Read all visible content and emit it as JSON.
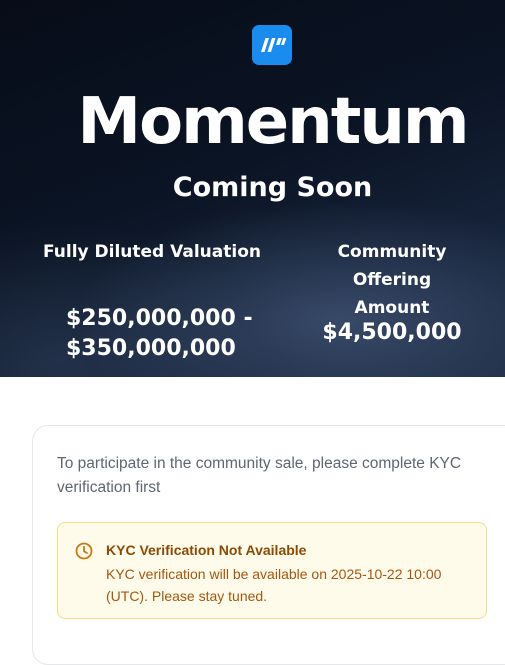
{
  "hero": {
    "logo_icon": "momentum-logo-icon",
    "brand_name": "Momentum",
    "status": "Coming Soon",
    "fdv": {
      "label": "Fully Diluted Valuation",
      "value_line1": "$250,000,000 -",
      "value_line2": "$350,000,000"
    },
    "community_offering": {
      "label_line1": "Community Offering",
      "label_line2": "Amount",
      "value": "$4,500,000"
    }
  },
  "sale_card": {
    "instructions": "To participate in the community sale, please complete KYC verification first",
    "notice": {
      "icon": "clock-icon",
      "title": "KYC Verification Not Available",
      "body": "KYC verification will be available on 2025-10-22 10:00 (UTC). Please stay tuned."
    }
  },
  "colors": {
    "logo_blue": "#1a8cf0",
    "notice_background": "#fffbeb",
    "notice_border": "#f6dc8a",
    "notice_title": "#8a4a06",
    "notice_text": "#a8560e",
    "muted_text": "#5f6673"
  }
}
